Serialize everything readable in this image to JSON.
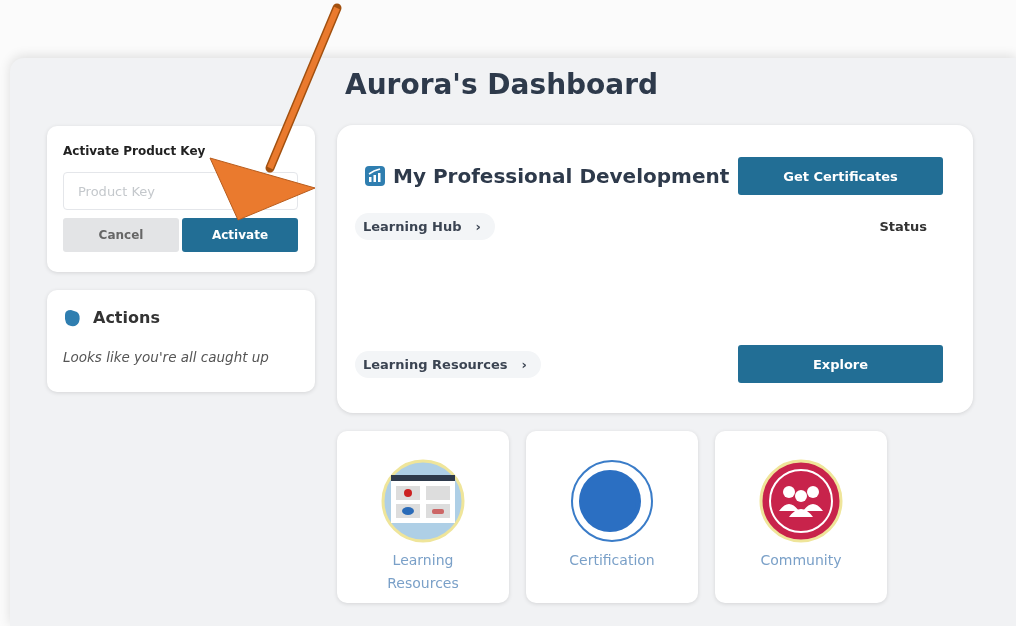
{
  "title": "Aurora's Dashboard",
  "product_key": {
    "heading": "Activate Product Key",
    "placeholder": "Product Key",
    "buttons": [
      {
        "label": "Cancel",
        "kind": "secondary"
      },
      {
        "label": "Activate",
        "kind": "primary"
      }
    ]
  },
  "actions": {
    "heading": "Actions",
    "message": "Looks like you're all caught up"
  },
  "development": {
    "heading": "My Professional Development",
    "button": "Get Certificates",
    "status": "Status",
    "links": [
      {
        "label": "Learning Hub",
        "chevron": "›"
      },
      {
        "label": "Learning Resources",
        "chevron": "›",
        "button": "Explore"
      }
    ]
  },
  "tiles": [
    {
      "label": "Learning Resources",
      "kind": "resources"
    },
    {
      "label": "Certification",
      "kind": "certification"
    },
    {
      "label": "Community",
      "kind": "community"
    }
  ]
}
